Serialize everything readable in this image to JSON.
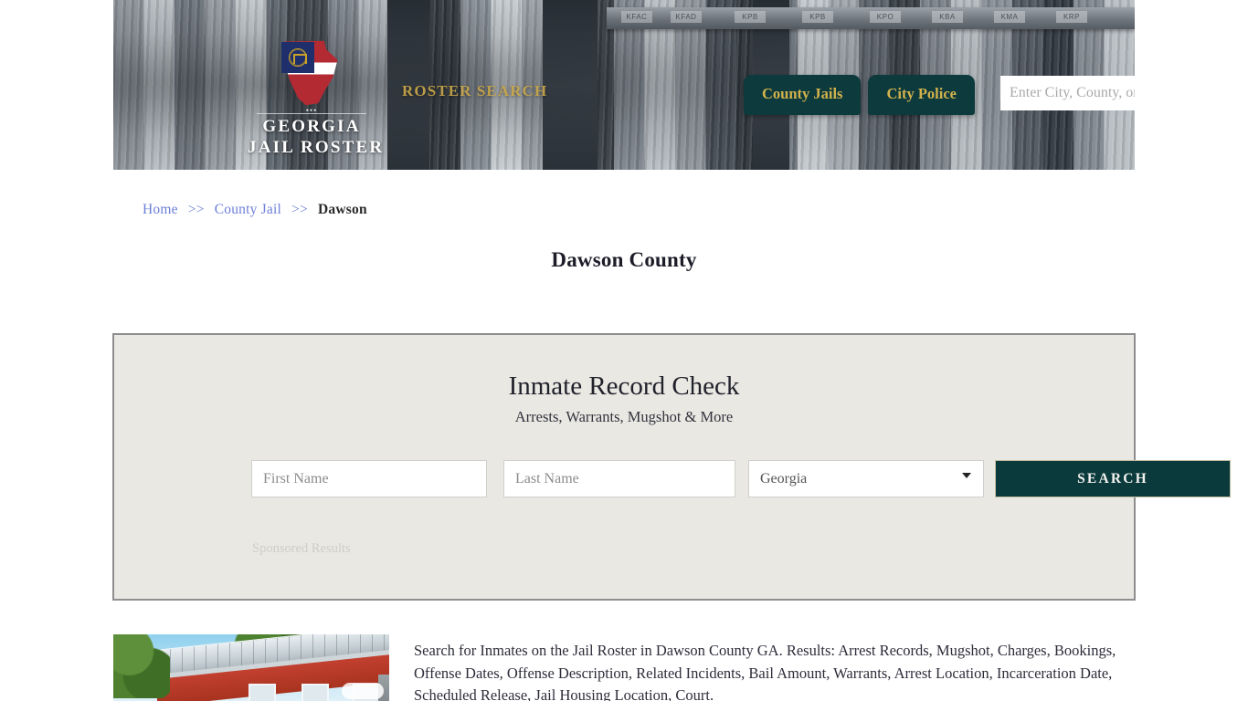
{
  "site": {
    "logo_line1": "GEORGIA",
    "logo_line2": "JAIL ROSTER",
    "tagline": "ROSTER SEARCH"
  },
  "header": {
    "nav": [
      {
        "label": "County Jails",
        "name": "county-jails"
      },
      {
        "label": "City Police",
        "name": "city-police"
      }
    ],
    "search": {
      "placeholder": "Enter City, County, or Facil",
      "value": "",
      "icon": "search-icon"
    }
  },
  "breadcrumb": {
    "home": "Home",
    "sep1": ">>",
    "county_jail": "County Jail",
    "sep2": ">>",
    "current": "Dawson"
  },
  "page": {
    "title": "Dawson County"
  },
  "record_panel": {
    "heading": "Inmate Record Check",
    "subheading": "Arrests, Warrants, Mugshot & More",
    "first_name_placeholder": "First Name",
    "first_name_value": "",
    "last_name_placeholder": "Last Name",
    "last_name_value": "",
    "state_selected": "Georgia",
    "state_options": [
      "Georgia"
    ],
    "search_button": "SEARCH",
    "sponsored_label": "Sponsored Results"
  },
  "content": {
    "thumbnail_alt": "Dawson County courthouse",
    "paragraph": "Search for Inmates on the Jail Roster in Dawson County GA. Results: Arrest Records, Mugshot, Charges, Bookings, Offense Dates, Offense Description, Related Incidents, Bail Amount, Warrants, Arrest Location, Incarceration Date, Scheduled Release, Jail Housing Location, Court."
  },
  "colors": {
    "teal": "#0c3a3d",
    "gold": "#d3b24c",
    "panel_bg": "#e9e8e3",
    "link_blue": "#6b7fd7"
  }
}
